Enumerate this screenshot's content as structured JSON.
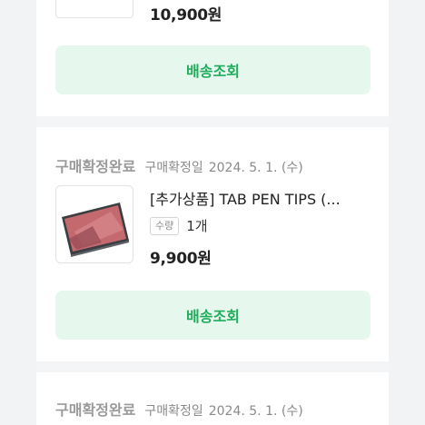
{
  "orders": [
    {
      "price": "10,900원",
      "ship_button": "배송조회"
    },
    {
      "status": "구매확정완료",
      "confirm_label": "구매확정일",
      "confirm_date": "2024. 5. 1. (수)",
      "product_name": "[추가상품] TAB PEN TIPS (...",
      "qty_label": "수량",
      "qty_value": "1개",
      "price": "9,900원",
      "ship_button": "배송조회"
    },
    {
      "status": "구매확정완료",
      "confirm_label": "구매확정일",
      "confirm_date": "2024. 5. 1. (수)"
    }
  ],
  "colors": {
    "accent_green": "#1fad5c",
    "button_bg": "#e6f7ee",
    "status_gray": "#9a9a9a"
  }
}
